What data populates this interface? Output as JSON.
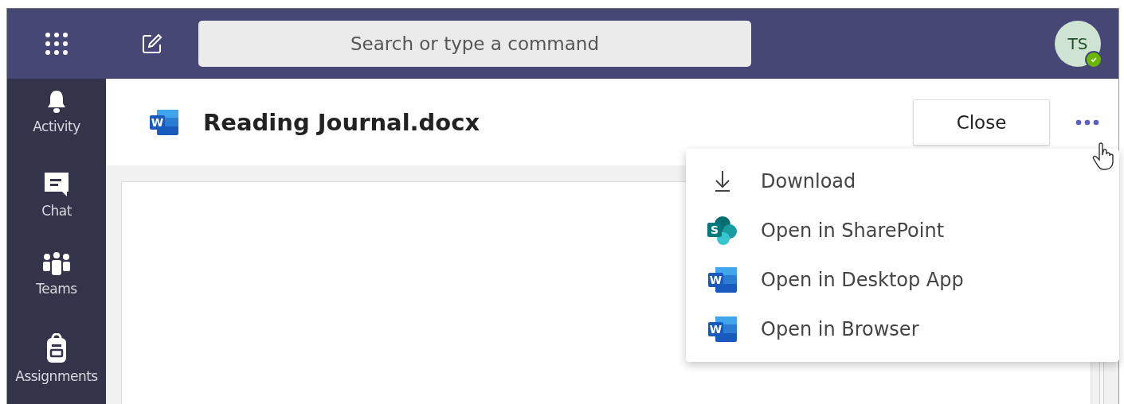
{
  "top_bar": {
    "search": {
      "placeholder": "Search or type a command"
    },
    "avatar": {
      "initials": "TS",
      "status": {
        "color": "#6bb700"
      }
    }
  },
  "sidebar": {
    "items": [
      {
        "kind": "bell",
        "label": "Activity",
        "selected": false
      },
      {
        "kind": "chat",
        "label": "Chat",
        "selected": false
      },
      {
        "kind": "teams",
        "label": "Teams",
        "selected": false
      },
      {
        "kind": "backpack",
        "label": "Assignments",
        "selected": false
      }
    ]
  },
  "file_header": {
    "icon_letter": "W",
    "title": "Reading Journal.docx",
    "close_button": "Close"
  },
  "more_menu": {
    "items": [
      {
        "kind": "download",
        "label": "Download"
      },
      {
        "kind": "sharepoint",
        "icon_letter": "S",
        "label": "Open in SharePoint"
      },
      {
        "kind": "word",
        "icon_letter": "W",
        "label": "Open in Desktop App"
      },
      {
        "kind": "word",
        "icon_letter": "W",
        "label": "Open in Browser"
      }
    ]
  }
}
